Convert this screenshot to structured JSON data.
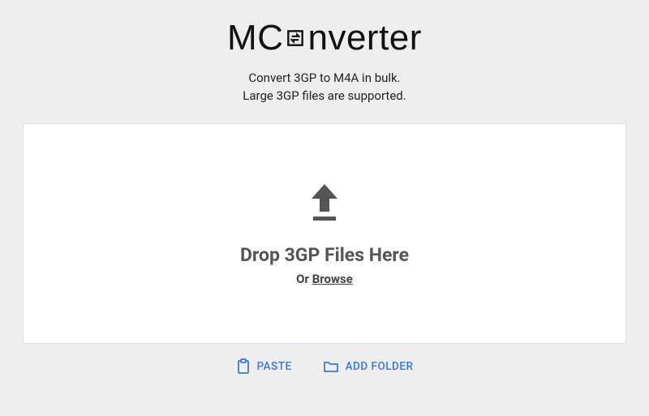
{
  "logo": {
    "part1": "MC",
    "part2": "nverter"
  },
  "subtitle": {
    "line1": "Convert 3GP to M4A in bulk.",
    "line2": "Large 3GP files are supported."
  },
  "dropzone": {
    "title": "Drop 3GP Files Here",
    "or": "Or ",
    "browse": "Browse"
  },
  "actions": {
    "paste": "PASTE",
    "add_folder": "ADD FOLDER"
  }
}
